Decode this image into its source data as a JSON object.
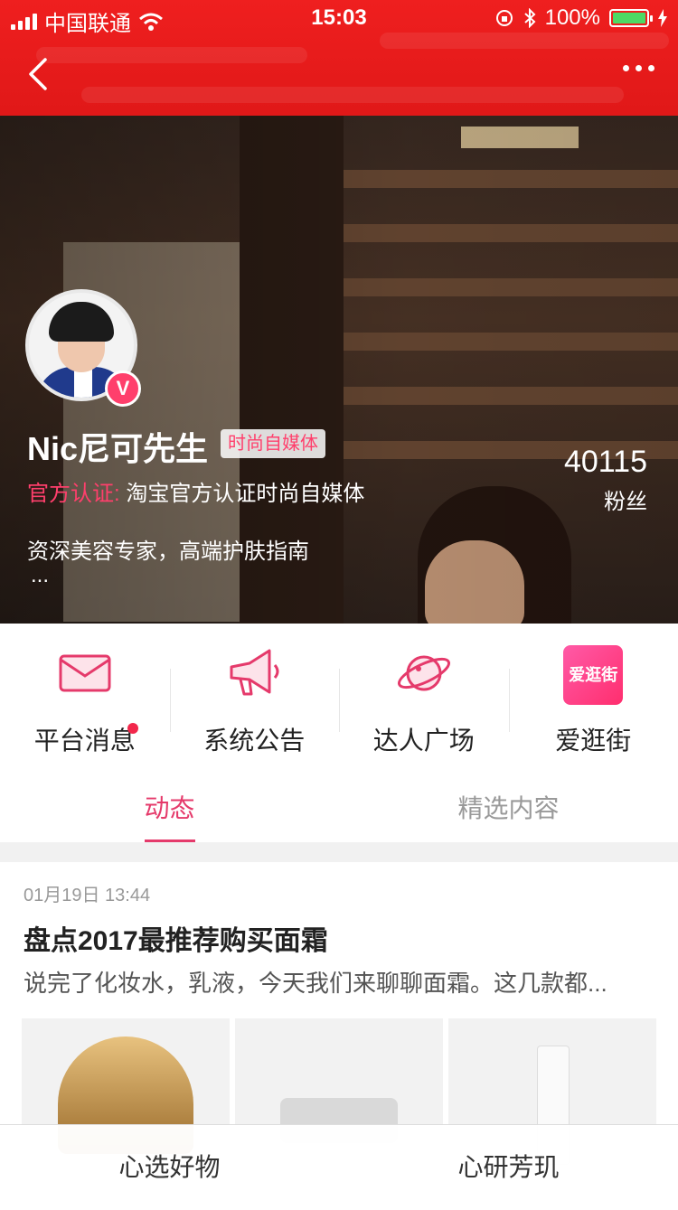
{
  "status_bar": {
    "carrier": "中国联通",
    "time": "15:03",
    "battery": "100%"
  },
  "profile": {
    "name": "Nic尼可先生",
    "tag": "时尚自媒体",
    "cert_key": "官方认证:",
    "cert_value": "淘宝官方认证时尚自媒体",
    "bio": "资深美容专家，高端护肤指南",
    "bio_more": "...",
    "fans_count": "40115",
    "fans_label": "粉丝",
    "badge": "V"
  },
  "menu": [
    {
      "label": "平台消息",
      "icon": "mail-icon"
    },
    {
      "label": "系统公告",
      "icon": "megaphone-icon"
    },
    {
      "label": "达人广场",
      "icon": "planet-icon"
    },
    {
      "label": "爱逛街",
      "icon": "aiguangjie-logo",
      "logo_text": "爱逛街"
    }
  ],
  "tabs": [
    {
      "label": "动态",
      "active": true
    },
    {
      "label": "精选内容",
      "active": false
    }
  ],
  "post": {
    "time": "01月19日 13:44",
    "title": "盘点2017最推荐购买面霜",
    "desc": "说完了化妆水，乳液，今天我们来聊聊面霜。这几款都..."
  },
  "bottom_bar": {
    "left": "心选好物",
    "right": "心研芳玑"
  },
  "colors": {
    "brand_red": "#e01818",
    "accent_pink": "#e53a6b",
    "notification_dot": "#f2274b"
  }
}
